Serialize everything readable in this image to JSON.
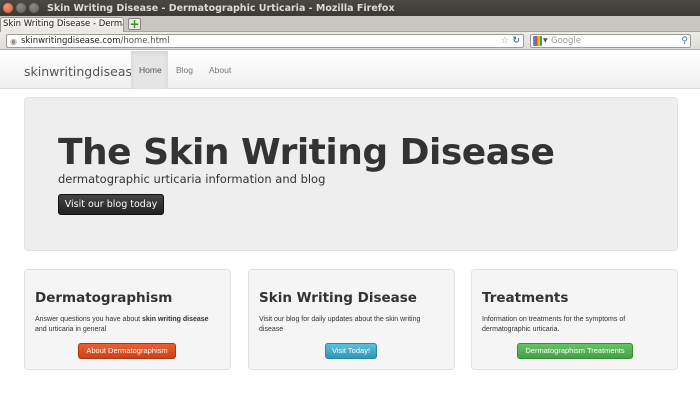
{
  "window": {
    "title": "Skin Writing Disease - Dermatographic Urticaria - Mozilla Firefox",
    "tab_label": "Skin Writing Disease - Dermat...",
    "new_tab_symbol": "+"
  },
  "urlbar": {
    "domain": "skinwritingdisease.com",
    "path": "/home.html"
  },
  "searchbar": {
    "placeholder": "Google"
  },
  "site": {
    "brand": "skinwritingdisease",
    "nav": [
      {
        "label": "Home",
        "active": true
      },
      {
        "label": "Blog",
        "active": false
      },
      {
        "label": "About",
        "active": false
      }
    ]
  },
  "hero": {
    "heading": "The Skin Writing Disease",
    "tagline": "dermatographic urticaria information and blog",
    "button": "Visit our blog today"
  },
  "cards": [
    {
      "title": "Dermatographism",
      "text_before": "Answer questions you have about ",
      "text_bold": "skin writing disease",
      "text_after": " and urticaria in general",
      "button": "About Dermatographism"
    },
    {
      "title": "Skin Writing Disease",
      "text": "Visit our blog for daily updates about the skin writing disease",
      "button": "Visit Today!"
    },
    {
      "title": "Treatments",
      "text": "Information on treatments for the symptoms of dermatographic urticaria.",
      "button": "Dermatographism Treatments"
    }
  ],
  "colors": {
    "orange_button": "#e35a2c",
    "blue_button": "#49afcd",
    "green_button": "#51a351",
    "dark_button": "#333333",
    "hero_bg": "#eeeeee"
  }
}
